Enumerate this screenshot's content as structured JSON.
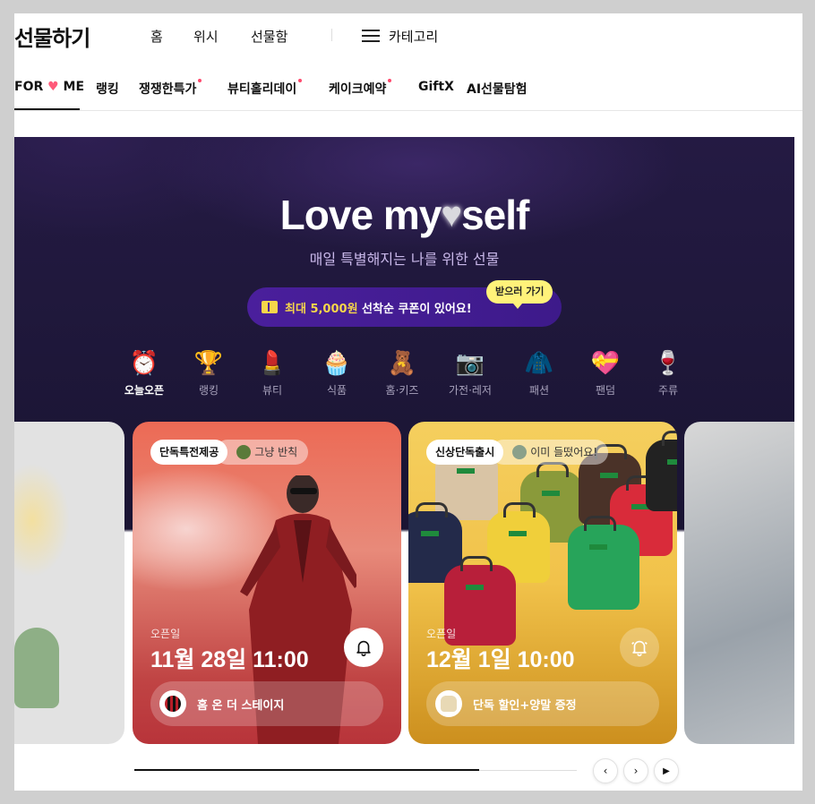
{
  "header": {
    "logo": "선물하기",
    "nav": [
      "홈",
      "위시",
      "선물함"
    ],
    "category_label": "카테고리"
  },
  "tabs": [
    {
      "label_prefix": "FOR ",
      "label_heart": "♥",
      "label_suffix": " ME",
      "active": true,
      "dot": false
    },
    {
      "label": "랭킹",
      "dot": false
    },
    {
      "label": "쟁쟁한특가",
      "dot": true
    },
    {
      "label": "뷰티홀리데이",
      "dot": true
    },
    {
      "label": "케이크예약",
      "dot": true
    },
    {
      "label": "GiftX",
      "dot": false
    },
    {
      "label": "AI선물탐험",
      "dot": false
    }
  ],
  "hero": {
    "title_left": "Love my",
    "title_heart": "♥",
    "title_right": "self",
    "subtitle": "매일 특별해지는 나를 위한 선물",
    "coupon_text_bold": "최대 5,000원",
    "coupon_text": " 선착순 쿠폰이 있어요!",
    "tooltip": "받으러 가기"
  },
  "categories": [
    {
      "label": "오늘오픈",
      "icon": "⏰",
      "icon_name": "alarm-clock-icon",
      "active": true
    },
    {
      "label": "랭킹",
      "icon": "🏆",
      "icon_name": "trophy-icon"
    },
    {
      "label": "뷰티",
      "icon": "💄",
      "icon_name": "lipstick-icon"
    },
    {
      "label": "식품",
      "icon": "🧁",
      "icon_name": "cupcake-icon"
    },
    {
      "label": "홈·키즈",
      "icon": "🧸",
      "icon_name": "teddy-bear-icon"
    },
    {
      "label": "가전·레저",
      "icon": "📷",
      "icon_name": "camera-icon"
    },
    {
      "label": "패션",
      "icon": "🧥",
      "icon_name": "jacket-icon"
    },
    {
      "label": "팬덤",
      "icon": "💝",
      "icon_name": "fandom-heart-icon"
    },
    {
      "label": "주류",
      "icon": "🍷",
      "icon_name": "wine-glass-icon"
    }
  ],
  "cards": [
    {
      "badge": "단독특전제공",
      "badge_sub": "그냥 반칙",
      "open_label": "오픈일",
      "open_date": "11월 28일 11:00",
      "cta": "홈 온 더 스테이지",
      "accent": "#ec6a55"
    },
    {
      "badge": "신상단독출시",
      "badge_sub": "이미 들떴어요!",
      "open_label": "오픈일",
      "open_date": "12월 1일 10:00",
      "cta": "단독 할인+양말 증정",
      "accent": "#f5cf5e"
    }
  ],
  "slider": {
    "progress": 0.78,
    "prev": "‹",
    "next": "›",
    "play": "▶"
  }
}
